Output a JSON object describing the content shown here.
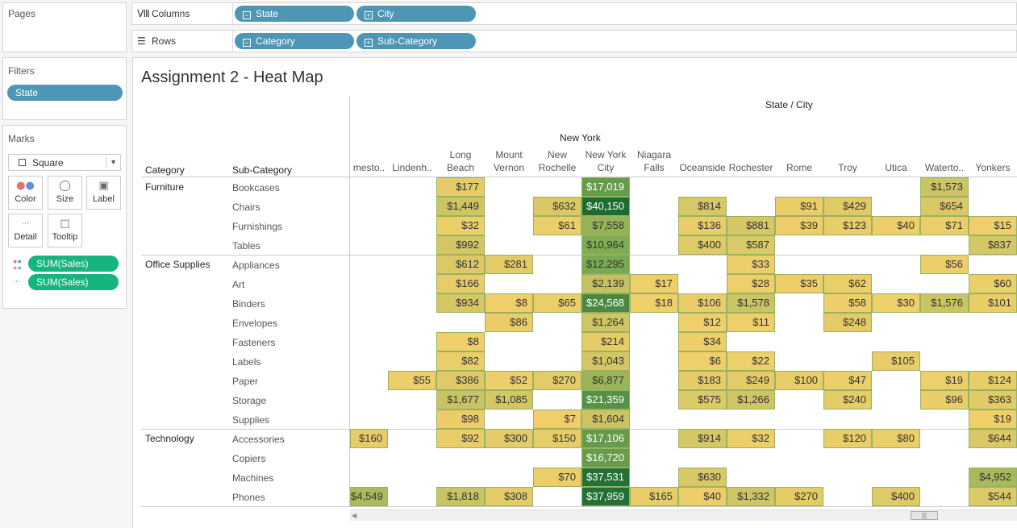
{
  "pages": {
    "title": "Pages"
  },
  "filters": {
    "title": "Filters",
    "pill": "State"
  },
  "marks": {
    "title": "Marks",
    "type": "Square",
    "buttons": [
      "Color",
      "Size",
      "Label",
      "Detail",
      "Tooltip"
    ],
    "pills": [
      "SUM(Sales)",
      "SUM(Sales)"
    ]
  },
  "shelves": {
    "columns_label": "Columns",
    "rows_label": "Rows",
    "columns": [
      "State",
      "City"
    ],
    "rows": [
      "Category",
      "Sub-Category"
    ]
  },
  "viz": {
    "title": "Assignment 2 - Heat Map",
    "header_group": "State / City",
    "state": "New York",
    "category_header": "Category",
    "subcategory_header": "Sub-Category",
    "cities": [
      [
        "mesto.."
      ],
      [
        "Lindenh.."
      ],
      [
        "Long",
        "Beach"
      ],
      [
        "Mount",
        "Vernon"
      ],
      [
        "New",
        "Rochelle"
      ],
      [
        "New York",
        "City"
      ],
      [
        "Niagara",
        "Falls"
      ],
      [
        "Oceanside"
      ],
      [
        "Rochester"
      ],
      [
        "Rome"
      ],
      [
        "Troy"
      ],
      [
        "Utica"
      ],
      [
        "Waterto.."
      ],
      [
        "Yonkers"
      ]
    ],
    "categories": [
      {
        "name": "Furniture",
        "subs": [
          "Bookcases",
          "Chairs",
          "Furnishings",
          "Tables"
        ]
      },
      {
        "name": "Office Supplies",
        "subs": [
          "Appliances",
          "Art",
          "Binders",
          "Envelopes",
          "Fasteners",
          "Labels",
          "Paper",
          "Storage",
          "Supplies"
        ]
      },
      {
        "name": "Technology",
        "subs": [
          "Accessories",
          "Copiers",
          "Machines",
          "Phones"
        ]
      }
    ]
  },
  "chart_data": {
    "type": "heatmap",
    "title": "Assignment 2 - Heat Map",
    "x_header": "State / City",
    "state": "New York",
    "x": [
      "mesto..",
      "Lindenh..",
      "Long Beach",
      "Mount Vernon",
      "New Rochelle",
      "New York City",
      "Niagara Falls",
      "Oceanside",
      "Rochester",
      "Rome",
      "Troy",
      "Utica",
      "Waterto..",
      "Yonkers"
    ],
    "y": [
      "Bookcases",
      "Chairs",
      "Furnishings",
      "Tables",
      "Appliances",
      "Art",
      "Binders",
      "Envelopes",
      "Fasteners",
      "Labels",
      "Paper",
      "Storage",
      "Supplies",
      "Accessories",
      "Copiers",
      "Machines",
      "Phones"
    ],
    "values": [
      [
        null,
        null,
        177,
        null,
        null,
        17019,
        null,
        null,
        null,
        null,
        null,
        null,
        1573,
        null
      ],
      [
        null,
        null,
        1449,
        null,
        632,
        40150,
        null,
        814,
        null,
        91,
        429,
        null,
        654,
        null
      ],
      [
        null,
        null,
        32,
        null,
        61,
        7558,
        null,
        136,
        881,
        39,
        123,
        40,
        71,
        15
      ],
      [
        null,
        null,
        992,
        null,
        null,
        10964,
        null,
        400,
        587,
        null,
        null,
        null,
        null,
        837
      ],
      [
        null,
        null,
        612,
        281,
        null,
        12295,
        null,
        null,
        33,
        null,
        null,
        null,
        56,
        null
      ],
      [
        null,
        null,
        166,
        null,
        null,
        2139,
        17,
        null,
        28,
        35,
        62,
        null,
        null,
        60
      ],
      [
        null,
        null,
        934,
        8,
        65,
        24568,
        18,
        106,
        1578,
        null,
        58,
        30,
        1576,
        101
      ],
      [
        null,
        null,
        null,
        86,
        null,
        1264,
        null,
        12,
        11,
        null,
        248,
        null,
        null,
        null
      ],
      [
        null,
        null,
        8,
        null,
        null,
        214,
        null,
        34,
        null,
        null,
        null,
        null,
        null,
        null
      ],
      [
        null,
        null,
        82,
        null,
        null,
        1043,
        null,
        6,
        22,
        null,
        null,
        105,
        null,
        null
      ],
      [
        null,
        55,
        386,
        52,
        270,
        6877,
        null,
        183,
        249,
        100,
        47,
        null,
        19,
        124
      ],
      [
        null,
        null,
        1677,
        1085,
        null,
        21359,
        null,
        575,
        1266,
        null,
        240,
        null,
        96,
        363
      ],
      [
        null,
        null,
        98,
        null,
        7,
        1604,
        null,
        null,
        null,
        null,
        null,
        null,
        null,
        19
      ],
      [
        160,
        null,
        92,
        300,
        150,
        17106,
        null,
        914,
        32,
        null,
        120,
        80,
        null,
        644
      ],
      [
        null,
        null,
        null,
        null,
        null,
        16720,
        null,
        null,
        null,
        null,
        null,
        null,
        null,
        null
      ],
      [
        null,
        null,
        null,
        null,
        70,
        37531,
        null,
        630,
        null,
        null,
        null,
        null,
        null,
        4952
      ],
      [
        4549,
        null,
        1818,
        308,
        null,
        37959,
        165,
        40,
        1332,
        270,
        null,
        400,
        null,
        544
      ]
    ],
    "labels": [
      [
        null,
        null,
        "$177",
        null,
        null,
        "$17,019",
        null,
        null,
        null,
        null,
        null,
        null,
        "$1,573",
        null
      ],
      [
        null,
        null,
        "$1,449",
        null,
        "$632",
        "$40,150",
        null,
        "$814",
        null,
        "$91",
        "$429",
        null,
        "$654",
        null
      ],
      [
        null,
        null,
        "$32",
        null,
        "$61",
        "$7,558",
        null,
        "$136",
        "$881",
        "$39",
        "$123",
        "$40",
        "$71",
        "$15"
      ],
      [
        null,
        null,
        "$992",
        null,
        null,
        "$10,964",
        null,
        "$400",
        "$587",
        null,
        null,
        null,
        null,
        "$837"
      ],
      [
        null,
        null,
        "$612",
        "$281",
        null,
        "$12,295",
        null,
        null,
        "$33",
        null,
        null,
        null,
        "$56",
        null
      ],
      [
        null,
        null,
        "$166",
        null,
        null,
        "$2,139",
        "$17",
        null,
        "$28",
        "$35",
        "$62",
        null,
        null,
        "$60"
      ],
      [
        null,
        null,
        "$934",
        "$8",
        "$65",
        "$24,568",
        "$18",
        "$106",
        "$1,578",
        null,
        "$58",
        "$30",
        "$1,576",
        "$101"
      ],
      [
        null,
        null,
        null,
        "$86",
        null,
        "$1,264",
        null,
        "$12",
        "$11",
        null,
        "$248",
        null,
        null,
        null
      ],
      [
        null,
        null,
        "$8",
        null,
        null,
        "$214",
        null,
        "$34",
        null,
        null,
        null,
        null,
        null,
        null
      ],
      [
        null,
        null,
        "$82",
        null,
        null,
        "$1,043",
        null,
        "$6",
        "$22",
        null,
        null,
        "$105",
        null,
        null
      ],
      [
        null,
        "$55",
        "$386",
        "$52",
        "$270",
        "$6,877",
        null,
        "$183",
        "$249",
        "$100",
        "$47",
        null,
        "$19",
        "$124"
      ],
      [
        null,
        null,
        "$1,677",
        "$1,085",
        null,
        "$21,359",
        null,
        "$575",
        "$1,266",
        null,
        "$240",
        null,
        "$96",
        "$363"
      ],
      [
        null,
        null,
        "$98",
        null,
        "$7",
        "$1,604",
        null,
        null,
        null,
        null,
        null,
        null,
        null,
        "$19"
      ],
      [
        "$160",
        null,
        "$92",
        "$300",
        "$150",
        "$17,106",
        null,
        "$914",
        "$32",
        null,
        "$120",
        "$80",
        null,
        "$644"
      ],
      [
        null,
        null,
        null,
        null,
        null,
        "$16,720",
        null,
        null,
        null,
        null,
        null,
        null,
        null,
        null
      ],
      [
        null,
        null,
        null,
        null,
        "$70",
        "$37,531",
        null,
        "$630",
        null,
        null,
        null,
        null,
        null,
        "$4,952"
      ],
      [
        "$4,549",
        null,
        "$1,818",
        "$308",
        null,
        "$37,959",
        "$165",
        "$40",
        "$1,332",
        "$270",
        null,
        "$400",
        null,
        "$544"
      ]
    ],
    "color_low": "#f2d06b",
    "color_high": "#1e6b32"
  }
}
